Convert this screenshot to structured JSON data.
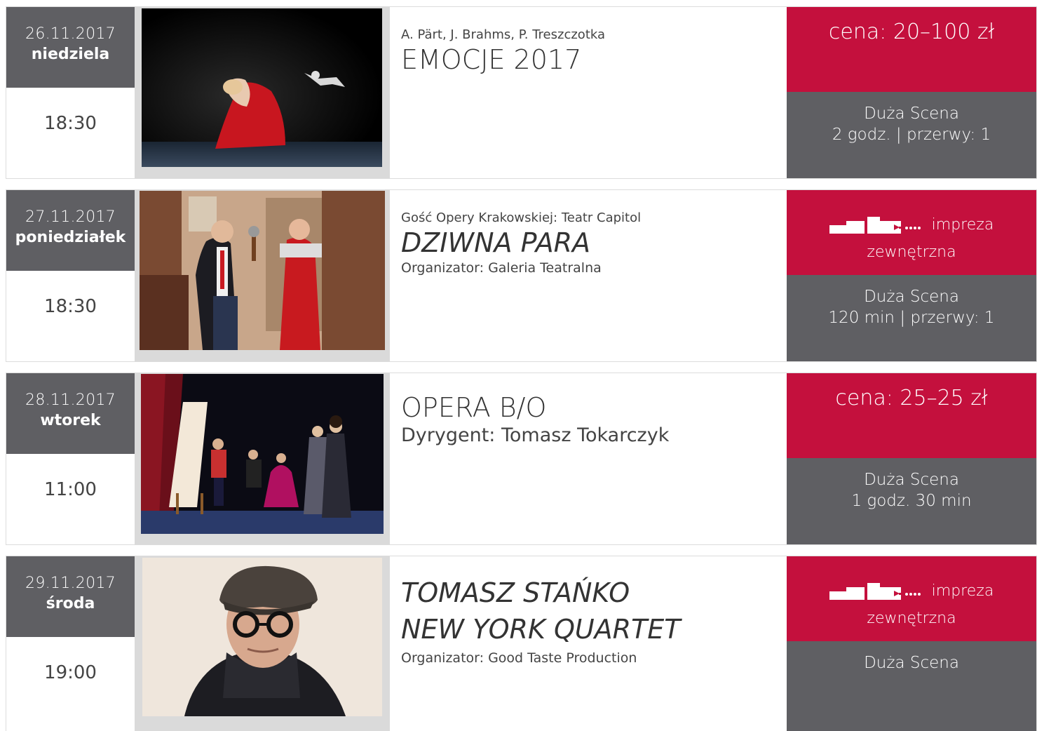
{
  "events": [
    {
      "date": "26.11.2017",
      "weekday": "niedziela",
      "time": "18:30",
      "image": "ballet-dancer-red-dress",
      "subtitle": "A. Pärt, J. Brahms, P. Treszczotka",
      "title": "EMOCJE 2017",
      "price": "cena: 20–100 zł",
      "venue": "Duża Scena",
      "duration": "2 godz. | przerwy: 1"
    },
    {
      "date": "27.11.2017",
      "weekday": "poniedziałek",
      "time": "18:30",
      "image": "two-men-comedy-stage",
      "subtitle": "Gość Opery Krakowskiej: Teatr Capitol",
      "title": "DZIWNA PARA",
      "organizer": "Organizator: Galeria Teatralna",
      "external_label_1": "impreza",
      "external_label_2": "zewnętrzna",
      "venue": "Duża Scena",
      "duration": "120 min | przerwy: 1"
    },
    {
      "date": "28.11.2017",
      "weekday": "wtorek",
      "time": "11:00",
      "image": "opera-stage-scene",
      "title": "OPERA B/O",
      "conductor": "Dyrygent: Tomasz Tokarczyk",
      "price": "cena: 25–25 zł",
      "venue": "Duża Scena",
      "duration": "1 godz. 30 min"
    },
    {
      "date": "29.11.2017",
      "weekday": "środa",
      "time": "19:00",
      "image": "portrait-man-flat-cap",
      "title_line1": "TOMASZ STAŃKO",
      "title_line2": "NEW YORK QUARTET",
      "organizer": "Organizator: Good Taste Production",
      "external_label_1": "impreza",
      "external_label_2": "zewnętrzna",
      "venue": "Duża Scena"
    }
  ],
  "colors": {
    "accent_red": "#c4103d",
    "panel_gray": "#5f5f63",
    "image_frame": "#dadada"
  }
}
